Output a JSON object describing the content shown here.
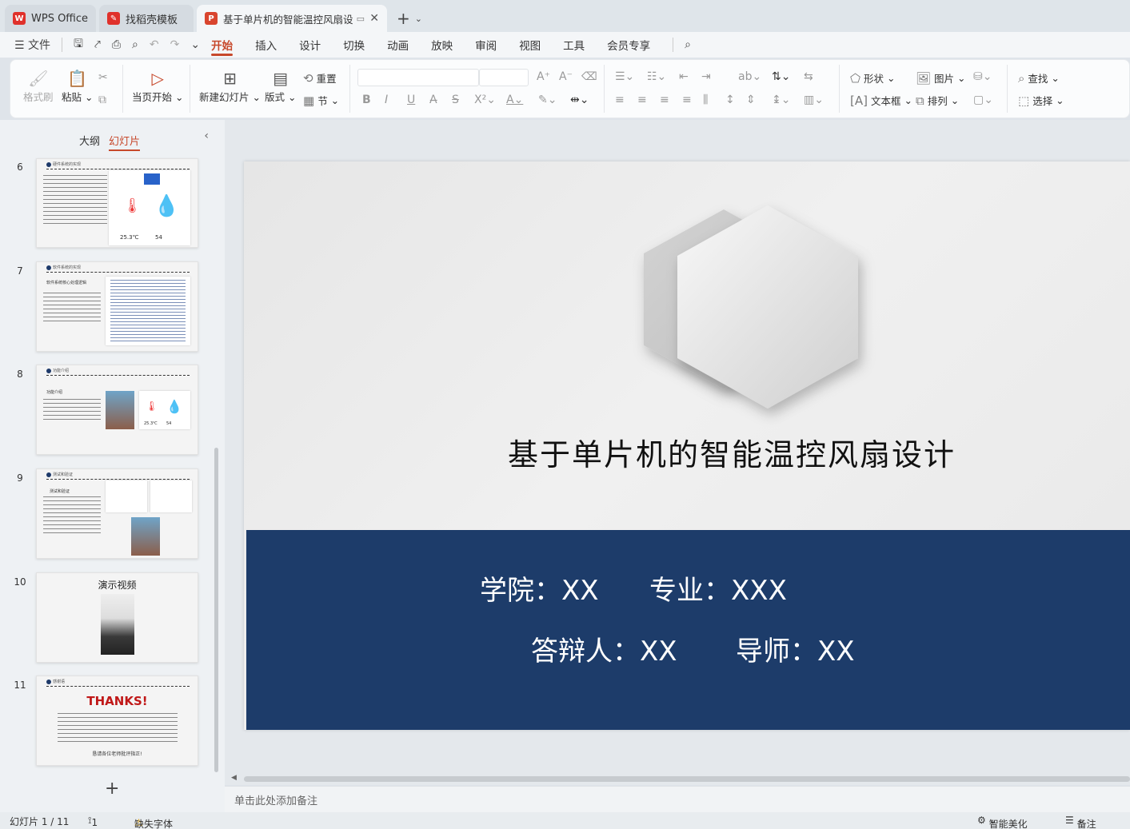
{
  "tabs": [
    {
      "label": "WPS Office",
      "logo": "W"
    },
    {
      "label": "找稻壳模板",
      "logo": "✎"
    },
    {
      "label": "基于单片机的智能温控风扇设计",
      "logo": "P"
    }
  ],
  "menu": {
    "file_label": "文件",
    "items": [
      "开始",
      "插入",
      "设计",
      "切换",
      "动画",
      "放映",
      "审阅",
      "视图",
      "工具",
      "会员专享"
    ],
    "active_index": 0
  },
  "ribbon": {
    "format_painter": "格式刷",
    "paste": "粘贴",
    "from_current": "当页开始",
    "new_slide": "新建幻灯片",
    "layout": "版式",
    "reset": "重置",
    "section": "节",
    "shape": "形状",
    "picture": "图片",
    "textbox": "文本框",
    "arrange": "排列",
    "find": "查找",
    "select": "选择"
  },
  "panel": {
    "tab_outline": "大纲",
    "tab_slides": "幻灯片",
    "slides": [
      {
        "num": "6",
        "title": "硬件系统的实现",
        "t1": "25.3℃",
        "t2": "54",
        "l1": "温度",
        "l2": "湿度"
      },
      {
        "num": "7",
        "title": "软件系统的实现",
        "sub": "软件系统核心处理逻辑"
      },
      {
        "num": "8",
        "title": "功能介绍",
        "sub": "功能介绍",
        "t1": "25.3℃",
        "t2": "54"
      },
      {
        "num": "9",
        "title": "测试和验证",
        "sub": "测试和验证"
      },
      {
        "num": "10",
        "title": "演示视频"
      },
      {
        "num": "11",
        "title": "感谢语",
        "thanks": "THANKS!",
        "closing": "恳请各位老师批评指正!"
      }
    ]
  },
  "slide": {
    "title": "基于单片机的智能温控风扇设计",
    "college": "学院：XX",
    "major": "专业：XXX",
    "defender": "答辩人：XX",
    "advisor": "导师：XX",
    "band_color": "#1d3c6a"
  },
  "notes_placeholder": "单击此处添加备注",
  "status": {
    "slide_count": "幻灯片 1 / 11",
    "comments": "1",
    "missing_font": "缺失字体",
    "smart_beautify": "智能美化",
    "notes": "备注"
  },
  "colors": {
    "accent": "#c7482b",
    "navy": "#1d3c6a"
  }
}
